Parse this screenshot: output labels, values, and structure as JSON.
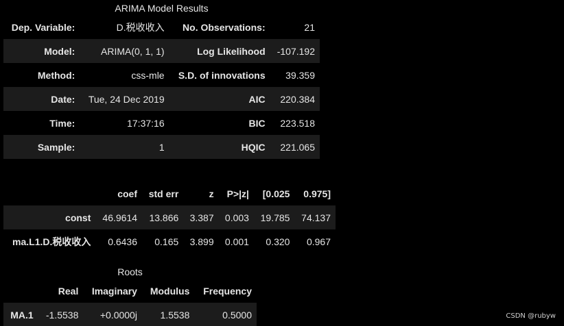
{
  "summary": {
    "title": "ARIMA Model Results",
    "rows": [
      {
        "k1": "Dep. Variable:",
        "v1": "D.税收收入",
        "k2": "No. Observations:",
        "v2": "21"
      },
      {
        "k1": "Model:",
        "v1": "ARIMA(0, 1, 1)",
        "k2": "Log Likelihood",
        "v2": "-107.192"
      },
      {
        "k1": "Method:",
        "v1": "css-mle",
        "k2": "S.D. of innovations",
        "v2": "39.359"
      },
      {
        "k1": "Date:",
        "v1": "Tue, 24 Dec 2019",
        "k2": "AIC",
        "v2": "220.384"
      },
      {
        "k1": "Time:",
        "v1": "17:37:16",
        "k2": "BIC",
        "v2": "223.518"
      },
      {
        "k1": "Sample:",
        "v1": "1",
        "k2": "HQIC",
        "v2": "221.065"
      }
    ]
  },
  "coef": {
    "headers": [
      "",
      "coef",
      "std err",
      "z",
      "P>|z|",
      "[0.025",
      "0.975]"
    ],
    "rows": [
      [
        "const",
        "46.9614",
        "13.866",
        "3.387",
        "0.003",
        "19.785",
        "74.137"
      ],
      [
        "ma.L1.D.税收收入",
        "0.6436",
        "0.165",
        "3.899",
        "0.001",
        "0.320",
        "0.967"
      ]
    ]
  },
  "roots": {
    "title": "Roots",
    "headers": [
      "",
      "Real",
      "Imaginary",
      "Modulus",
      "Frequency"
    ],
    "rows": [
      [
        "MA.1",
        "-1.5538",
        "+0.0000j",
        "1.5538",
        "0.5000"
      ]
    ]
  },
  "watermark": "CSDN @rubyw"
}
